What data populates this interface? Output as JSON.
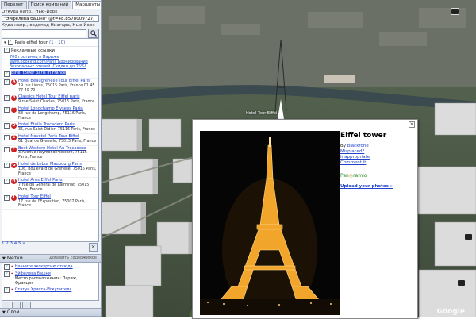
{
  "tabs": [
    "Перелет",
    "Поиск компаний",
    "Маршруты"
  ],
  "active_tab": 2,
  "from_label": "Откуда напр., Нью-Йорк",
  "from_value": "\"Эйфелева башня\" @t=48.8578009727,",
  "to_label": "Куда напр., водопад Ниагара, Нью-Йорк",
  "to_value": "",
  "results_title": "Paris eiffel tour",
  "results_count": "(1 - 10)",
  "ad_title": "Рекламные ссылки",
  "ad_text": "700 гостиниц в Париже www.booking.com/Paris Бронирование безопасных отелей. Скидки до 75%!",
  "results": [
    {
      "marker": "",
      "name": "Eiffel tower paris in France",
      "addr": "",
      "selected": true
    },
    {
      "marker": "A",
      "name": "Hotel Beaugrenelle Tour Eiffel Paris",
      "addr": "19 rue Linois, 75015 Paris, France 01 45 77 40 70",
      "selected": false
    },
    {
      "marker": "B",
      "name": "Classics Hotel Tour Eiffel paris",
      "addr": "9 rue Saint Charles, 75015 Paris, France",
      "selected": false
    },
    {
      "marker": "C",
      "name": "Hotel Longchamp Elysees Paris",
      "addr": "68 rue de Longchamp, 75116 Paris, France",
      "selected": false
    },
    {
      "marker": "D",
      "name": "Hotel Etoile Trocadero Paris",
      "addr": "35, rue Saint Didier, 75116 Paris, France",
      "selected": false
    },
    {
      "marker": "E",
      "name": "Hotel Novotel Paris Tour Eiffel",
      "addr": "61 Quai de Grenelle, 75015 Paris, France",
      "selected": false
    },
    {
      "marker": "F",
      "name": "Best Western Hotel Au Trocadero",
      "addr": "3 Avenue Raymond Poincaré, 75116 Paris, France",
      "selected": false
    },
    {
      "marker": "G",
      "name": "Hotel de Lebur Maubourg Paris",
      "addr": "106, Boulevard de Grenelle, 75015 Paris, France",
      "selected": false
    },
    {
      "marker": "H",
      "name": "Hotel Ares Eiffel Paris",
      "addr": "7 rue du General de Larminat, 75015 Paris, France",
      "selected": false
    },
    {
      "marker": "I",
      "name": "Hotel Tour Eiffel",
      "addr": "17 rue de l'Exposition, 75007 Paris, France",
      "selected": false
    }
  ],
  "pages": "1 2 3 4 5 »",
  "section_places": "Метки",
  "section_places_sub": "Добавить содержимое",
  "places": [
    {
      "name": "Начните экскурсию отсюда",
      "sub": ""
    },
    {
      "name": "Эйфелева башня",
      "sub": "Место расположения: Париж, Франция"
    },
    {
      "name": "Статуя Христа-Искупителя",
      "sub": ""
    }
  ],
  "section_layers": "Слои",
  "map_labels": [
    {
      "text": "Hotel Tour Eiffel"
    }
  ],
  "popup": {
    "title": "Eiffel tower",
    "by": "By",
    "author": "blackrone",
    "links": [
      "Misplaced?",
      "Inappropriate",
      "Comment it"
    ],
    "pano_prefix": "Pan",
    "pano_suffix": "ramio",
    "upload": "Upload your photos »"
  },
  "brand": "Google",
  "colors": {
    "link": "#2244cc",
    "marker": "#cc2222",
    "tower_light": "#f5b030"
  }
}
